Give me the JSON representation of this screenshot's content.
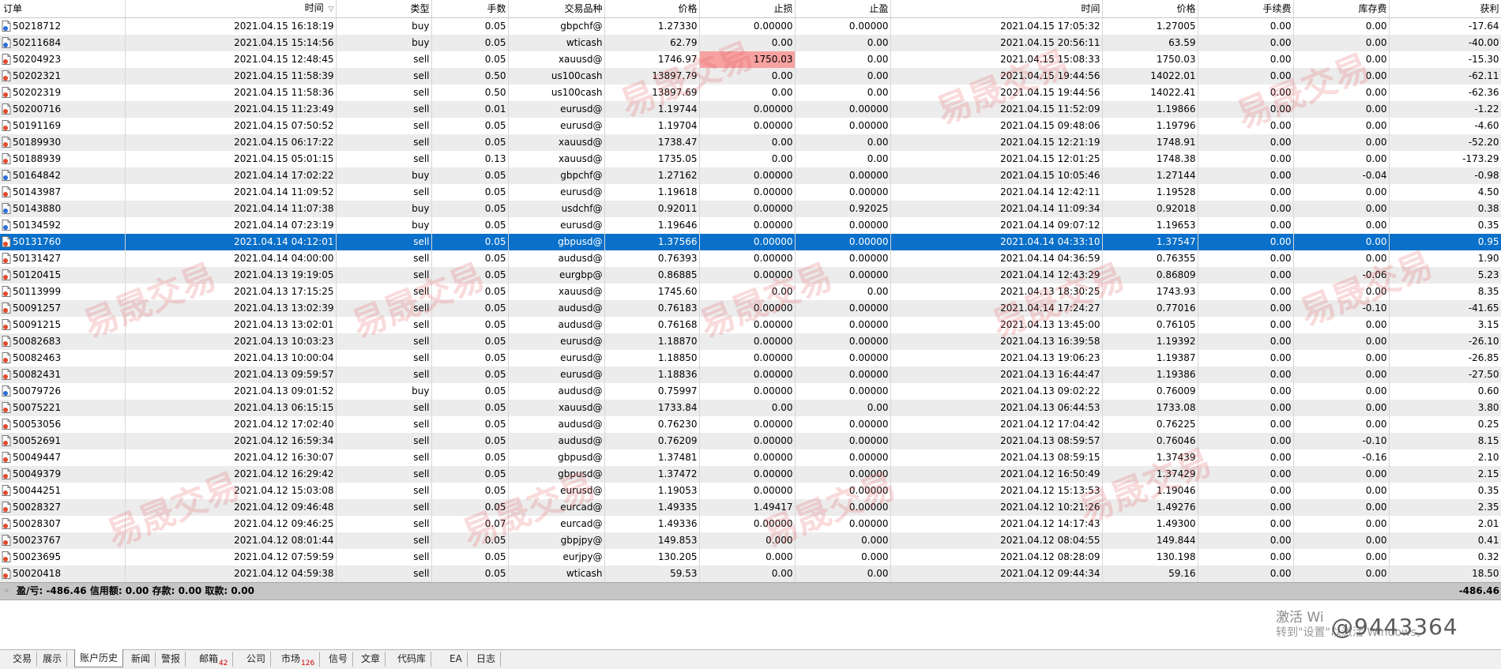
{
  "columns": [
    "订单",
    "时间",
    "类型",
    "手数",
    "交易品种",
    "价格",
    "止损",
    "止盈",
    "时间",
    "价格",
    "手续费",
    "库存费",
    "获利"
  ],
  "sort_indicator": "▽",
  "rows": [
    {
      "order": "50218712",
      "open_time": "2021.04.15 16:18:19",
      "type": "buy",
      "lots": "0.05",
      "symbol": "gbpchf@",
      "open_price": "1.27330",
      "sl": "0.00000",
      "tp": "0.00000",
      "close_time": "2021.04.15 17:05:32",
      "close_price": "1.27005",
      "commission": "0.00",
      "swap": "0.00",
      "profit": "-17.64"
    },
    {
      "order": "50211684",
      "open_time": "2021.04.15 15:14:56",
      "type": "buy",
      "lots": "0.05",
      "symbol": "wticash",
      "open_price": "62.79",
      "sl": "0.00",
      "tp": "0.00",
      "close_time": "2021.04.15 20:56:11",
      "close_price": "63.59",
      "commission": "0.00",
      "swap": "0.00",
      "profit": "-40.00"
    },
    {
      "order": "50204923",
      "open_time": "2021.04.15 12:48:45",
      "type": "sell",
      "lots": "0.05",
      "symbol": "xauusd@",
      "open_price": "1746.97",
      "sl": "1750.03",
      "tp": "0.00",
      "close_time": "2021.04.15 15:08:33",
      "close_price": "1750.03",
      "commission": "0.00",
      "swap": "0.00",
      "profit": "-15.30",
      "sl_hit": true
    },
    {
      "order": "50202321",
      "open_time": "2021.04.15 11:58:39",
      "type": "sell",
      "lots": "0.50",
      "symbol": "us100cash",
      "open_price": "13897.79",
      "sl": "0.00",
      "tp": "0.00",
      "close_time": "2021.04.15 19:44:56",
      "close_price": "14022.01",
      "commission": "0.00",
      "swap": "0.00",
      "profit": "-62.11"
    },
    {
      "order": "50202319",
      "open_time": "2021.04.15 11:58:36",
      "type": "sell",
      "lots": "0.50",
      "symbol": "us100cash",
      "open_price": "13897.69",
      "sl": "0.00",
      "tp": "0.00",
      "close_time": "2021.04.15 19:44:56",
      "close_price": "14022.41",
      "commission": "0.00",
      "swap": "0.00",
      "profit": "-62.36"
    },
    {
      "order": "50200716",
      "open_time": "2021.04.15 11:23:49",
      "type": "sell",
      "lots": "0.01",
      "symbol": "eurusd@",
      "open_price": "1.19744",
      "sl": "0.00000",
      "tp": "0.00000",
      "close_time": "2021.04.15 11:52:09",
      "close_price": "1.19866",
      "commission": "0.00",
      "swap": "0.00",
      "profit": "-1.22"
    },
    {
      "order": "50191169",
      "open_time": "2021.04.15 07:50:52",
      "type": "sell",
      "lots": "0.05",
      "symbol": "eurusd@",
      "open_price": "1.19704",
      "sl": "0.00000",
      "tp": "0.00000",
      "close_time": "2021.04.15 09:48:06",
      "close_price": "1.19796",
      "commission": "0.00",
      "swap": "0.00",
      "profit": "-4.60"
    },
    {
      "order": "50189930",
      "open_time": "2021.04.15 06:17:22",
      "type": "sell",
      "lots": "0.05",
      "symbol": "xauusd@",
      "open_price": "1738.47",
      "sl": "0.00",
      "tp": "0.00",
      "close_time": "2021.04.15 12:21:19",
      "close_price": "1748.91",
      "commission": "0.00",
      "swap": "0.00",
      "profit": "-52.20"
    },
    {
      "order": "50188939",
      "open_time": "2021.04.15 05:01:15",
      "type": "sell",
      "lots": "0.13",
      "symbol": "xauusd@",
      "open_price": "1735.05",
      "sl": "0.00",
      "tp": "0.00",
      "close_time": "2021.04.15 12:01:25",
      "close_price": "1748.38",
      "commission": "0.00",
      "swap": "0.00",
      "profit": "-173.29"
    },
    {
      "order": "50164842",
      "open_time": "2021.04.14 17:02:22",
      "type": "buy",
      "lots": "0.05",
      "symbol": "gbpchf@",
      "open_price": "1.27162",
      "sl": "0.00000",
      "tp": "0.00000",
      "close_time": "2021.04.15 10:05:46",
      "close_price": "1.27144",
      "commission": "0.00",
      "swap": "-0.04",
      "profit": "-0.98"
    },
    {
      "order": "50143987",
      "open_time": "2021.04.14 11:09:52",
      "type": "sell",
      "lots": "0.05",
      "symbol": "eurusd@",
      "open_price": "1.19618",
      "sl": "0.00000",
      "tp": "0.00000",
      "close_time": "2021.04.14 12:42:11",
      "close_price": "1.19528",
      "commission": "0.00",
      "swap": "0.00",
      "profit": "4.50"
    },
    {
      "order": "50143880",
      "open_time": "2021.04.14 11:07:38",
      "type": "buy",
      "lots": "0.05",
      "symbol": "usdchf@",
      "open_price": "0.92011",
      "sl": "0.00000",
      "tp": "0.92025",
      "close_time": "2021.04.14 11:09:34",
      "close_price": "0.92018",
      "commission": "0.00",
      "swap": "0.00",
      "profit": "0.38"
    },
    {
      "order": "50134592",
      "open_time": "2021.04.14 07:23:19",
      "type": "buy",
      "lots": "0.05",
      "symbol": "eurusd@",
      "open_price": "1.19646",
      "sl": "0.00000",
      "tp": "0.00000",
      "close_time": "2021.04.14 09:07:12",
      "close_price": "1.19653",
      "commission": "0.00",
      "swap": "0.00",
      "profit": "0.35"
    },
    {
      "order": "50131760",
      "open_time": "2021.04.14 04:12:01",
      "type": "sell",
      "lots": "0.05",
      "symbol": "gbpusd@",
      "open_price": "1.37566",
      "sl": "0.00000",
      "tp": "0.00000",
      "close_time": "2021.04.14 04:33:10",
      "close_price": "1.37547",
      "commission": "0.00",
      "swap": "0.00",
      "profit": "0.95",
      "selected": true
    },
    {
      "order": "50131427",
      "open_time": "2021.04.14 04:00:00",
      "type": "sell",
      "lots": "0.05",
      "symbol": "audusd@",
      "open_price": "0.76393",
      "sl": "0.00000",
      "tp": "0.00000",
      "close_time": "2021.04.14 04:36:59",
      "close_price": "0.76355",
      "commission": "0.00",
      "swap": "0.00",
      "profit": "1.90"
    },
    {
      "order": "50120415",
      "open_time": "2021.04.13 19:19:05",
      "type": "sell",
      "lots": "0.05",
      "symbol": "eurgbp@",
      "open_price": "0.86885",
      "sl": "0.00000",
      "tp": "0.00000",
      "close_time": "2021.04.14 12:43:29",
      "close_price": "0.86809",
      "commission": "0.00",
      "swap": "-0.06",
      "profit": "5.23"
    },
    {
      "order": "50113999",
      "open_time": "2021.04.13 17:15:25",
      "type": "sell",
      "lots": "0.05",
      "symbol": "xauusd@",
      "open_price": "1745.60",
      "sl": "0.00",
      "tp": "0.00",
      "close_time": "2021.04.13 18:30:25",
      "close_price": "1743.93",
      "commission": "0.00",
      "swap": "0.00",
      "profit": "8.35"
    },
    {
      "order": "50091257",
      "open_time": "2021.04.13 13:02:39",
      "type": "sell",
      "lots": "0.05",
      "symbol": "audusd@",
      "open_price": "0.76183",
      "sl": "0.00000",
      "tp": "0.00000",
      "close_time": "2021.04.14 17:24:27",
      "close_price": "0.77016",
      "commission": "0.00",
      "swap": "-0.10",
      "profit": "-41.65"
    },
    {
      "order": "50091215",
      "open_time": "2021.04.13 13:02:01",
      "type": "sell",
      "lots": "0.05",
      "symbol": "audusd@",
      "open_price": "0.76168",
      "sl": "0.00000",
      "tp": "0.00000",
      "close_time": "2021.04.13 13:45:00",
      "close_price": "0.76105",
      "commission": "0.00",
      "swap": "0.00",
      "profit": "3.15"
    },
    {
      "order": "50082683",
      "open_time": "2021.04.13 10:03:23",
      "type": "sell",
      "lots": "0.05",
      "symbol": "eurusd@",
      "open_price": "1.18870",
      "sl": "0.00000",
      "tp": "0.00000",
      "close_time": "2021.04.13 16:39:58",
      "close_price": "1.19392",
      "commission": "0.00",
      "swap": "0.00",
      "profit": "-26.10"
    },
    {
      "order": "50082463",
      "open_time": "2021.04.13 10:00:04",
      "type": "sell",
      "lots": "0.05",
      "symbol": "eurusd@",
      "open_price": "1.18850",
      "sl": "0.00000",
      "tp": "0.00000",
      "close_time": "2021.04.13 19:06:23",
      "close_price": "1.19387",
      "commission": "0.00",
      "swap": "0.00",
      "profit": "-26.85"
    },
    {
      "order": "50082431",
      "open_time": "2021.04.13 09:59:57",
      "type": "sell",
      "lots": "0.05",
      "symbol": "eurusd@",
      "open_price": "1.18836",
      "sl": "0.00000",
      "tp": "0.00000",
      "close_time": "2021.04.13 16:44:47",
      "close_price": "1.19386",
      "commission": "0.00",
      "swap": "0.00",
      "profit": "-27.50"
    },
    {
      "order": "50079726",
      "open_time": "2021.04.13 09:01:52",
      "type": "buy",
      "lots": "0.05",
      "symbol": "audusd@",
      "open_price": "0.75997",
      "sl": "0.00000",
      "tp": "0.00000",
      "close_time": "2021.04.13 09:02:22",
      "close_price": "0.76009",
      "commission": "0.00",
      "swap": "0.00",
      "profit": "0.60"
    },
    {
      "order": "50075221",
      "open_time": "2021.04.13 06:15:15",
      "type": "sell",
      "lots": "0.05",
      "symbol": "xauusd@",
      "open_price": "1733.84",
      "sl": "0.00",
      "tp": "0.00",
      "close_time": "2021.04.13 06:44:53",
      "close_price": "1733.08",
      "commission": "0.00",
      "swap": "0.00",
      "profit": "3.80"
    },
    {
      "order": "50053056",
      "open_time": "2021.04.12 17:02:40",
      "type": "sell",
      "lots": "0.05",
      "symbol": "audusd@",
      "open_price": "0.76230",
      "sl": "0.00000",
      "tp": "0.00000",
      "close_time": "2021.04.12 17:04:42",
      "close_price": "0.76225",
      "commission": "0.00",
      "swap": "0.00",
      "profit": "0.25"
    },
    {
      "order": "50052691",
      "open_time": "2021.04.12 16:59:34",
      "type": "sell",
      "lots": "0.05",
      "symbol": "audusd@",
      "open_price": "0.76209",
      "sl": "0.00000",
      "tp": "0.00000",
      "close_time": "2021.04.13 08:59:57",
      "close_price": "0.76046",
      "commission": "0.00",
      "swap": "-0.10",
      "profit": "8.15"
    },
    {
      "order": "50049447",
      "open_time": "2021.04.12 16:30:07",
      "type": "sell",
      "lots": "0.05",
      "symbol": "gbpusd@",
      "open_price": "1.37481",
      "sl": "0.00000",
      "tp": "0.00000",
      "close_time": "2021.04.13 08:59:15",
      "close_price": "1.37439",
      "commission": "0.00",
      "swap": "-0.16",
      "profit": "2.10"
    },
    {
      "order": "50049379",
      "open_time": "2021.04.12 16:29:42",
      "type": "sell",
      "lots": "0.05",
      "symbol": "gbpusd@",
      "open_price": "1.37472",
      "sl": "0.00000",
      "tp": "0.00000",
      "close_time": "2021.04.12 16:50:49",
      "close_price": "1.37429",
      "commission": "0.00",
      "swap": "0.00",
      "profit": "2.15"
    },
    {
      "order": "50044251",
      "open_time": "2021.04.12 15:03:08",
      "type": "sell",
      "lots": "0.05",
      "symbol": "eurusd@",
      "open_price": "1.19053",
      "sl": "0.00000",
      "tp": "0.00000",
      "close_time": "2021.04.12 15:13:53",
      "close_price": "1.19046",
      "commission": "0.00",
      "swap": "0.00",
      "profit": "0.35"
    },
    {
      "order": "50028327",
      "open_time": "2021.04.12 09:46:48",
      "type": "sell",
      "lots": "0.05",
      "symbol": "eurcad@",
      "open_price": "1.49335",
      "sl": "1.49417",
      "tp": "0.00000",
      "close_time": "2021.04.12 10:21:26",
      "close_price": "1.49276",
      "commission": "0.00",
      "swap": "0.00",
      "profit": "2.35"
    },
    {
      "order": "50028307",
      "open_time": "2021.04.12 09:46:25",
      "type": "sell",
      "lots": "0.07",
      "symbol": "eurcad@",
      "open_price": "1.49336",
      "sl": "0.00000",
      "tp": "0.00000",
      "close_time": "2021.04.12 14:17:43",
      "close_price": "1.49300",
      "commission": "0.00",
      "swap": "0.00",
      "profit": "2.01"
    },
    {
      "order": "50023767",
      "open_time": "2021.04.12 08:01:44",
      "type": "sell",
      "lots": "0.05",
      "symbol": "gbpjpy@",
      "open_price": "149.853",
      "sl": "0.000",
      "tp": "0.000",
      "close_time": "2021.04.12 08:04:55",
      "close_price": "149.844",
      "commission": "0.00",
      "swap": "0.00",
      "profit": "0.41"
    },
    {
      "order": "50023695",
      "open_time": "2021.04.12 07:59:59",
      "type": "sell",
      "lots": "0.05",
      "symbol": "eurjpy@",
      "open_price": "130.205",
      "sl": "0.000",
      "tp": "0.000",
      "close_time": "2021.04.12 08:28:09",
      "close_price": "130.198",
      "commission": "0.00",
      "swap": "0.00",
      "profit": "0.32"
    },
    {
      "order": "50020418",
      "open_time": "2021.04.12 04:59:38",
      "type": "sell",
      "lots": "0.05",
      "symbol": "wticash",
      "open_price": "59.53",
      "sl": "0.00",
      "tp": "0.00",
      "close_time": "2021.04.12 09:44:34",
      "close_price": "59.16",
      "commission": "0.00",
      "swap": "0.00",
      "profit": "18.50"
    }
  ],
  "summary": {
    "text": "盈/亏: -486.46  信用额: 0.00  存款: 0.00  取款: 0.00",
    "total": "-486.46"
  },
  "watermarks": {
    "brand": "易晟交易",
    "activate_line1": "激活 Wi",
    "activate_line2": "转到\"设置\"以激活 Windows。",
    "social": "@9443364"
  },
  "tabs": [
    {
      "label": "交易"
    },
    {
      "label": "展示"
    },
    {
      "label": "账户历史",
      "active": true
    },
    {
      "label": "新闻"
    },
    {
      "label": "警报"
    },
    {
      "label": "邮箱",
      "badge": "42"
    },
    {
      "label": "公司"
    },
    {
      "label": "市场",
      "badge": "126"
    },
    {
      "label": "信号"
    },
    {
      "label": "文章"
    },
    {
      "label": "代码库"
    },
    {
      "label": "EA"
    },
    {
      "label": "日志"
    }
  ],
  "colors": {
    "selected_row": "#0a70c9",
    "stop_loss_hit": "#f7a1a1",
    "buy_icon": "#2a6fd6",
    "sell_icon": "#e04a2a",
    "badge": "#d00000"
  }
}
